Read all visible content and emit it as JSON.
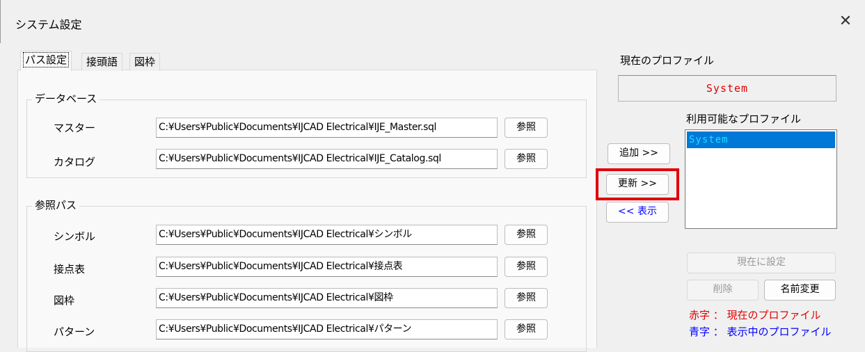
{
  "window": {
    "title": "システム設定",
    "close_glyph": "✕"
  },
  "tabs": [
    {
      "label": "パス設定",
      "active": true
    },
    {
      "label": "接頭語",
      "active": false
    },
    {
      "label": "図枠",
      "active": false
    }
  ],
  "database_group": {
    "title": "データベース",
    "rows": [
      {
        "label": "マスター",
        "path": "C:¥Users¥Public¥Documents¥IJCAD Electrical¥IJE_Master.sql",
        "button": "参照"
      },
      {
        "label": "カタログ",
        "path": "C:¥Users¥Public¥Documents¥IJCAD Electrical¥IJE_Catalog.sql",
        "button": "参照"
      }
    ]
  },
  "ref_paths_group": {
    "title": "参照パス",
    "rows": [
      {
        "label": "シンボル",
        "path": "C:¥Users¥Public¥Documents¥IJCAD Electrical¥シンボル",
        "button": "参照"
      },
      {
        "label": "接点表",
        "path": "C:¥Users¥Public¥Documents¥IJCAD Electrical¥接点表",
        "button": "参照"
      },
      {
        "label": "図枠",
        "path": "C:¥Users¥Public¥Documents¥IJCAD Electrical¥図枠",
        "button": "参照"
      },
      {
        "label": "パターン",
        "path": "C:¥Users¥Public¥Documents¥IJCAD Electrical¥パターン",
        "button": "参照"
      }
    ]
  },
  "profile": {
    "current_label": "現在のプロファイル",
    "current_value": "System",
    "available_label": "利用可能なプロファイル",
    "available": [
      "System"
    ],
    "add_button": "追加 >>",
    "update_button": "更新 >>",
    "show_button": "<< 表示",
    "set_current_button": "現在に設定",
    "delete_button": "削除",
    "rename_button": "名前変更",
    "legend_red": "赤字 ： 現在のプロファイル",
    "legend_blue": "青字 ： 表示中のプロファイル"
  },
  "colors": {
    "current_profile": "#e00000",
    "shown_profile": "#0000ff",
    "highlight": "#e0000a",
    "selection": "#0078d7"
  }
}
